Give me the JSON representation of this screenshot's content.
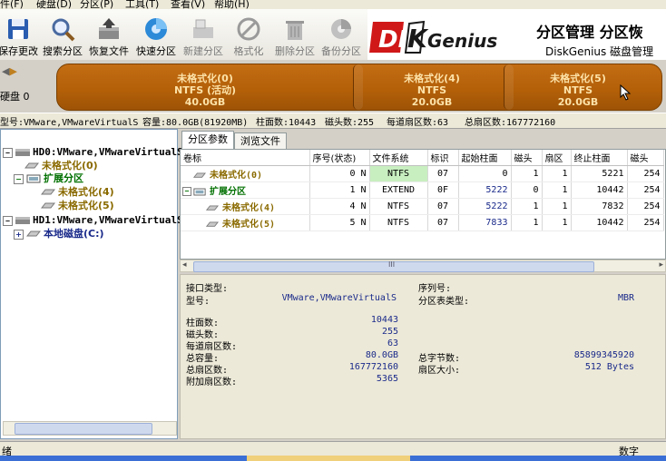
{
  "menu": [
    "件(F)",
    "硬盘(D)",
    "分区(P)",
    "工具(T)",
    "查看(V)",
    "帮助(H)"
  ],
  "toolbar": {
    "buttons": [
      {
        "label": "保存更改",
        "icon": "save-icon"
      },
      {
        "label": "搜索分区",
        "icon": "search-icon"
      },
      {
        "label": "恢复文件",
        "icon": "recover-icon"
      },
      {
        "label": "快速分区",
        "icon": "quick-partition-icon"
      },
      {
        "label": "新建分区",
        "icon": "new-partition-icon"
      },
      {
        "label": "格式化",
        "icon": "format-icon"
      },
      {
        "label": "删除分区",
        "icon": "delete-icon"
      },
      {
        "label": "备份分区",
        "icon": "backup-icon"
      }
    ]
  },
  "brand": {
    "logo": "DISKGenius",
    "title": "分区管理 分区恢",
    "subtitle": "DiskGenius 磁盘管理"
  },
  "disk_map": {
    "label": "硬盘 0",
    "partitions": [
      {
        "name": "未格式化(0)",
        "fs": "NTFS (活动)",
        "size": "40.0GB"
      },
      {
        "name": "未格式化(4)",
        "fs": "NTFS",
        "size": "20.0GB"
      },
      {
        "name": "未格式化(5)",
        "fs": "NTFS",
        "size": "20.0GB"
      }
    ]
  },
  "disk_info": {
    "model": "型号:VMware,VMwareVirtualS",
    "capacity": "容量:80.0GB(81920MB)",
    "cylinders": "柱面数:10443",
    "heads": "磁头数:255",
    "sectors_per_track": "每道扇区数:63",
    "total_sectors": "总扇区数:167772160"
  },
  "tree": {
    "hd0": "HD0:VMware,VMwareVirtualS",
    "hd0_p0": "未格式化(0)",
    "hd0_ext": "扩展分区",
    "hd0_p4": "未格式化(4)",
    "hd0_p5": "未格式化(5)",
    "hd1": "HD1:VMware,VMwareVirtualS",
    "hd1_c": "本地磁盘(C:)"
  },
  "tabs": [
    "分区参数",
    "浏览文件"
  ],
  "grid": {
    "headers": [
      "卷标",
      "序号(状态)",
      "文件系统",
      "标识",
      "起始柱面",
      "磁头",
      "扇区",
      "终止柱面",
      "磁头"
    ],
    "rows": [
      {
        "label": "未格式化(0)",
        "seq": "0 N",
        "fs": "NTFS",
        "id": "07",
        "start_cyl": "0",
        "head": "1",
        "sector": "1",
        "end_cyl": "5221",
        "end_head": "254"
      },
      {
        "label": "扩展分区",
        "seq": "1 N",
        "fs": "EXTEND",
        "id": "0F",
        "start_cyl": "5222",
        "head": "0",
        "sector": "1",
        "end_cyl": "10442",
        "end_head": "254"
      },
      {
        "label": "未格式化(4)",
        "seq": "4 N",
        "fs": "NTFS",
        "id": "07",
        "start_cyl": "5222",
        "head": "1",
        "sector": "1",
        "end_cyl": "7832",
        "end_head": "254"
      },
      {
        "label": "未格式化(5)",
        "seq": "5 N",
        "fs": "NTFS",
        "id": "07",
        "start_cyl": "7833",
        "head": "1",
        "sector": "1",
        "end_cyl": "10442",
        "end_head": "254"
      }
    ],
    "scroll_mark": "III"
  },
  "details": {
    "interface_type_label": "接口类型:",
    "model_label": "型号:",
    "model_value": "VMware,VMwareVirtualS",
    "serial_label": "序列号:",
    "ptable_label": "分区表类型:",
    "ptable_value": "MBR",
    "cylinders_label": "柱面数:",
    "cylinders_value": "10443",
    "heads_label": "磁头数:",
    "heads_value": "255",
    "spt_label": "每道扇区数:",
    "spt_value": "63",
    "capacity_label": "总容量:",
    "capacity_value": "80.0GB",
    "total_sectors_label": "总扇区数:",
    "total_sectors_value": "167772160",
    "extra_sectors_label": "附加扇区数:",
    "extra_sectors_value": "5365",
    "total_bytes_label": "总字节数:",
    "total_bytes_value": "85899345920",
    "sector_size_label": "扇区大小:",
    "sector_size_value": "512 Bytes"
  },
  "status": {
    "left": "绪",
    "right": "数字"
  },
  "colors": {
    "disk_bar": "#b25f08",
    "partition_text": "#fde2a8",
    "unformatted": "#8a6a00",
    "extended": "#007000",
    "ntfs_highlight": "#c8efc0",
    "value_text": "#1a2a8a"
  }
}
